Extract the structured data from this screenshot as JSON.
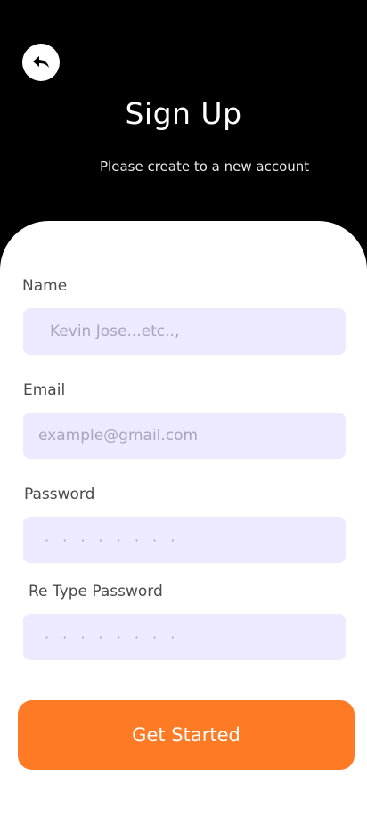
{
  "header": {
    "back_icon": "reply-arrow-icon",
    "title": "Sign Up",
    "subtitle": "Please create to a new account"
  },
  "form": {
    "name": {
      "label": "Name",
      "placeholder": "Kevin Jose...etc..,"
    },
    "email": {
      "label": "Email",
      "placeholder": "example@gmail.com"
    },
    "password": {
      "label": "Password",
      "placeholder": "· · · · · · · ·"
    },
    "retype_password": {
      "label": "Re Type Password",
      "placeholder": "· · · · · · · ·"
    }
  },
  "cta": {
    "label": "Get Started"
  },
  "colors": {
    "background": "#000000",
    "card": "#ffffff",
    "field": "#ede9fe",
    "accent": "#ff7a24"
  }
}
